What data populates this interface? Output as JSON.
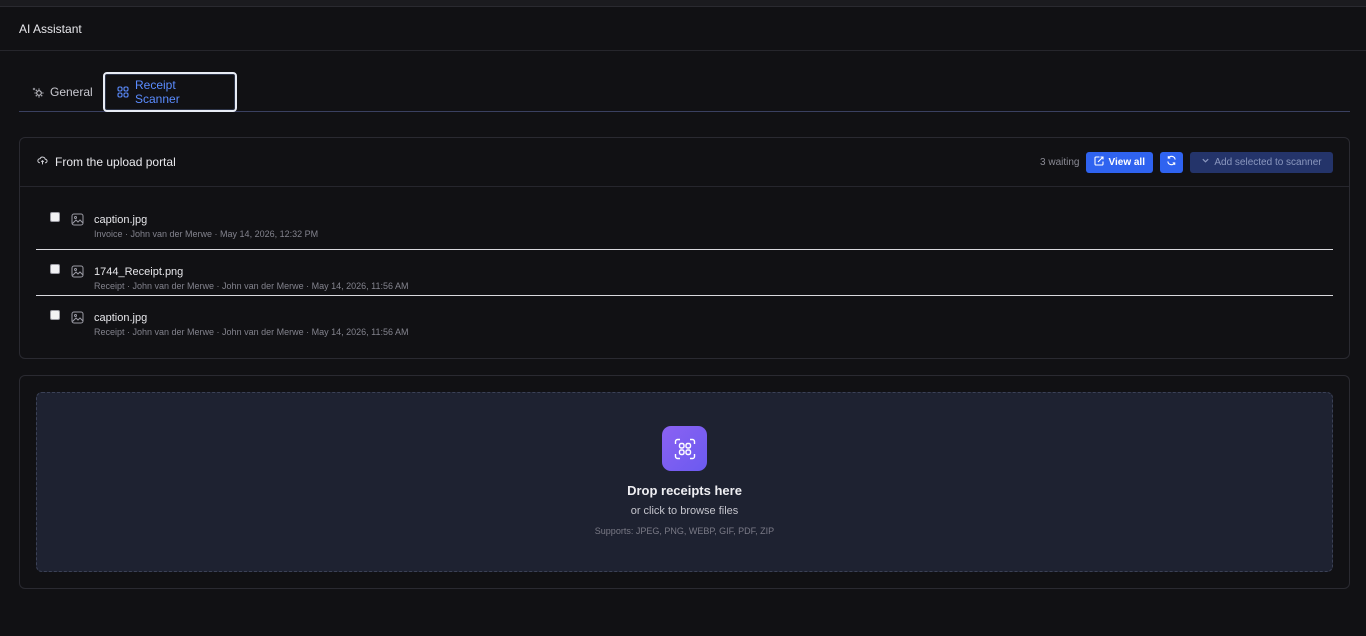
{
  "app": {
    "title": "AI Assistant"
  },
  "tabs": [
    {
      "label": "General",
      "icon": "sparkle-gear-icon",
      "active": false
    },
    {
      "label": "Receipt Scanner",
      "icon": "scan-icon",
      "active": true
    }
  ],
  "upload_portal": {
    "title": "From the upload portal",
    "icon": "cloud-upload-icon",
    "waiting_text": "3 waiting",
    "view_all_label": "View all",
    "refresh_icon": "refresh-icon",
    "add_selected_label": "Add selected to scanner",
    "items": [
      {
        "filename": "caption.jpg",
        "meta": "Invoice · John van der Merwe · May 14, 2026, 12:32 PM"
      },
      {
        "filename": "1744_Receipt.png",
        "meta": "Receipt · John van der Merwe · John van der Merwe · May 14, 2026, 11:56 AM"
      },
      {
        "filename": "caption.jpg",
        "meta": "Receipt · John van der Merwe · John van der Merwe · May 14, 2026, 11:56 AM"
      }
    ]
  },
  "dropzone": {
    "icon": "scan-icon",
    "title": "Drop receipts here",
    "subtitle": "or click to browse files",
    "supports": "Supports: JPEG, PNG, WEBP, GIF, PDF, ZIP"
  },
  "colors": {
    "accent": "#2f63f0",
    "active_tab_text": "#5b8cff",
    "drop_icon": "#7b5ef2",
    "background": "#111114"
  }
}
